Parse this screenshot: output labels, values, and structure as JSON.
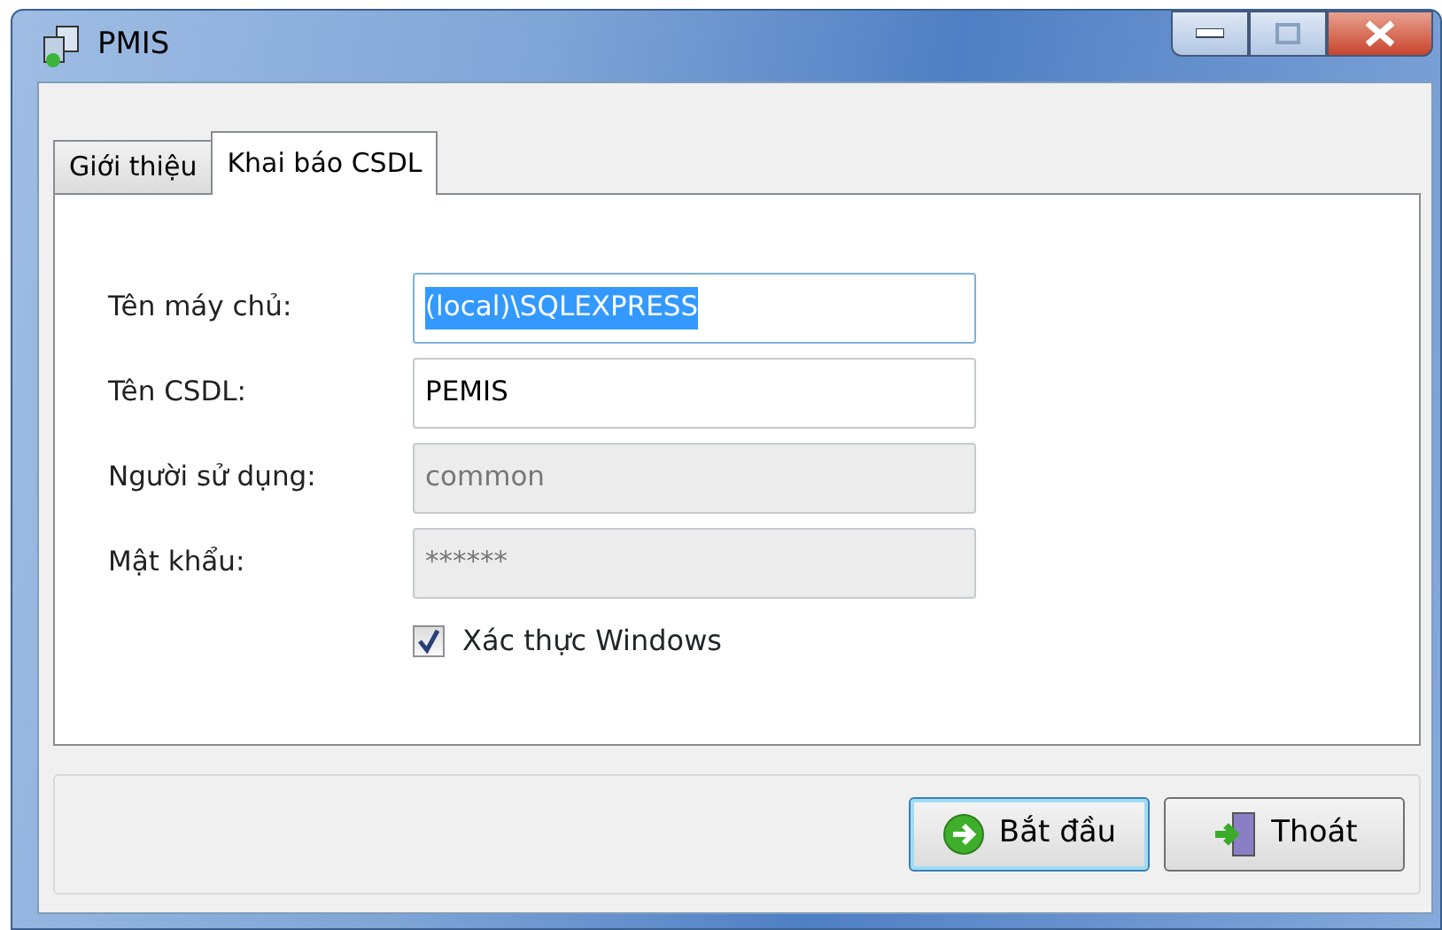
{
  "window": {
    "title": "PMIS"
  },
  "tabs": [
    {
      "label": "Giới thiệu",
      "selected": false
    },
    {
      "label": "Khai báo CSDL",
      "selected": true
    }
  ],
  "fields": [
    {
      "label": "Tên máy chủ:",
      "value": "(local)\\SQLEXPRESS",
      "disabled": false,
      "highlighted": true
    },
    {
      "label": "Tên CSDL:",
      "value": "PEMIS",
      "disabled": false,
      "highlighted": false
    },
    {
      "label": "Người sử dụng:",
      "value": "common",
      "disabled": true,
      "highlighted": false
    },
    {
      "label": "Mật khẩu:",
      "value": "******",
      "disabled": true,
      "highlighted": false
    }
  ],
  "checkbox": {
    "label": "Xác thực Windows",
    "checked": true
  },
  "buttons": [
    {
      "label": "Bắt đầu",
      "kind": "start",
      "default": true
    },
    {
      "label": "Thoát",
      "kind": "exit",
      "default": false
    }
  ]
}
